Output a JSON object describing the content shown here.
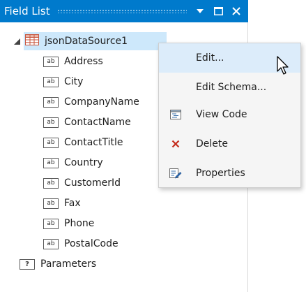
{
  "panel": {
    "title": "Field List",
    "title_bar_color": "#007acc",
    "window_buttons": [
      "dropdown-icon",
      "maximize-icon",
      "close-icon"
    ]
  },
  "tree": {
    "root": {
      "label": "jsonDataSource1",
      "icon": "table-icon",
      "expanded": true,
      "selected": true
    },
    "fields": [
      {
        "label": "Address",
        "icon_text": "ab"
      },
      {
        "label": "City",
        "icon_text": "ab"
      },
      {
        "label": "CompanyName",
        "icon_text": "ab"
      },
      {
        "label": "ContactName",
        "icon_text": "ab"
      },
      {
        "label": "ContactTitle",
        "icon_text": "ab"
      },
      {
        "label": "Country",
        "icon_text": "ab"
      },
      {
        "label": "CustomerId",
        "icon_text": "ab"
      },
      {
        "label": "Fax",
        "icon_text": "ab"
      },
      {
        "label": "Phone",
        "icon_text": "ab"
      },
      {
        "label": "PostalCode",
        "icon_text": "ab"
      }
    ],
    "parameters": {
      "label": "Parameters",
      "icon_text": "?"
    }
  },
  "context_menu": {
    "items": [
      {
        "label": "Edit...",
        "icon": "",
        "highlighted": true
      },
      {
        "label": "Edit Schema...",
        "icon": ""
      },
      {
        "label": "View Code",
        "icon": "view-code-icon"
      },
      {
        "label": "Delete",
        "icon": "delete-icon",
        "color": "#c42b1c"
      },
      {
        "label": "Properties",
        "icon": "properties-icon"
      }
    ]
  }
}
